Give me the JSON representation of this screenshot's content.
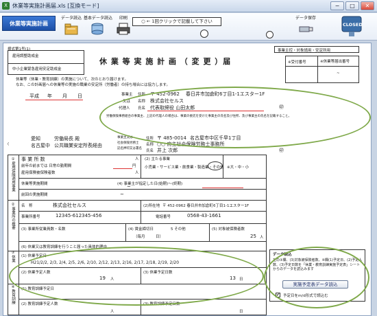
{
  "window": {
    "title": "休業等実施計画届.xls [互換モード]",
    "min": "−",
    "max": "□",
    "close": "✕"
  },
  "toolbar": {
    "app_label": "休業等実施計画",
    "data_read": "データ読込",
    "basic_data_read": "基本データ読込",
    "print": "印刷",
    "memo": "○ ← 1回クリックで記載して下さい",
    "data_save": "データ保存",
    "closed": "CLOSED"
  },
  "form": {
    "form_no": "様式第1号(1)",
    "recipients": [
      "雇用調整助成金",
      "中小企業緊急雇用安定助成金"
    ],
    "title": "休 業 等 実 施 計 画 （ 変 更 ）届",
    "top_right_label": "事業主控・対象請用・安定所用",
    "side_labels": [
      "※受付番号",
      "※休業等届出番号"
    ],
    "side_tilde": "~",
    "intro_1": "休業等（休業・教育訓練）の実施について、次のとおり届けます。",
    "intro_2": "なお、この計画届への休業等の実施の職業の安定所（労働者）の持ち場合には協力します。",
    "date": {
      "era": "平成",
      "year": "年",
      "month": "月",
      "day": "日"
    },
    "employer": {
      "label": "事業主",
      "addr_label": "住所",
      "zip": "〒 452-0962",
      "address": "春日井市加倉町6丁目1-1エスター1F",
      "name_label": "名称",
      "name_prefix": "又は",
      "name": "株式会社セルス",
      "rep_label": "代理人",
      "rep_name_label": "氏名",
      "rep_name": "代表取締役 山田太郎",
      "seal": "㊞"
    },
    "small_note": "労働保険事務組合の事業主、上記の代理人の場合は、事業の委託を受けた事業主の氏名及び住所、及び事業主の氏名を記載すること。",
    "office": {
      "prefecture": "愛知",
      "bureau": "労働局長 殿",
      "second": "名古屋中",
      "office_name": "公共職業安定所長経由"
    },
    "agent": {
      "label_1": "事業主又は",
      "label_2": "社会保険労務士",
      "label_3": "記名押印又は署名",
      "addr_label": "住所",
      "zip": "〒 485-0014",
      "address": "名古屋市中区千早1丁目",
      "name_label": "名称",
      "name": "○○ 府主社会保険労務士事務所",
      "person_label": "氏名",
      "person": "井上 次郎",
      "seal": "㊞"
    },
    "section1": {
      "row_label_1": "雇用保険適用事業所",
      "col_business": "事 業 所 数",
      "col_business_unit": "人",
      "col_industry": "(2) 主たる事業",
      "row_prev": "前年の前までは 日常の勤期間",
      "row_prev_unit": "円",
      "row_workers": "雇用保険被保険者数",
      "row_workers_unit": "人",
      "industry_options": "小売業・サービス業・飲食業・製造業・その他",
      "industry_selected": "その他",
      "size_note": "※大・中・小",
      "period_label": "休業等実施期間",
      "period_value": "~",
      "period_note": "(4) 事業主が指定した日(始期)～(終期)",
      "prev_label": "前回の実施期間",
      "prev_value": "~"
    },
    "section2": {
      "name_label": "名　称",
      "name": "株式会社セルス",
      "addr_label": "(2)所在地",
      "addr": "〒 452-0962 春日井市加倉町6丁目1-1エスター1F",
      "insurance_label": "事業所番号",
      "insurance_no": "12345-612345-456",
      "tel_label": "電話番号",
      "tel": "0568-43-1661",
      "count_label": "(3) 事業所従業員数・名数",
      "wage_label": "(4) 賃金締切日",
      "wage_cycle": "（毎月",
      "wage_day": "日）",
      "wage_other": "5 その他",
      "target_label": "(5) 対象被保険者数",
      "target_value": "25",
      "target_unit": "人",
      "applied_label": "(6) 休業又は教育訓練を行うこと届った具体的理由"
    },
    "section3": {
      "days_label": "(1) 休業予定日",
      "days_value": "H21/2/2, 2/3, 2/4, 2/5, 2/6, 2/10, 2/12, 2/13, 2/16, 2/17, 2/18, 2/19, 2/20",
      "workers_label": "(2) 休業予定人数",
      "workers_value": "19",
      "workers_unit": "人",
      "days_count_label": "(3) 休業予定日数",
      "days_count_value": "13",
      "days_count_unit": "日"
    },
    "section4": {
      "edu_days_label": "(1) 教育訓練予定日",
      "edu_workers_label": "(2) 教育訓練予定人数",
      "edu_workers_unit": "人",
      "edu_days_count_label": "(3) 教育訓練予定日数",
      "edu_days_count_unit": "日"
    },
    "left_sections": [
      "①雇用保険適用事業",
      "②事業所の概要",
      "③休業",
      "④教育訓練"
    ],
    "panel": {
      "title": "データ読込",
      "text": "左の③欄、(3)対象被保険者数、④欄(1)予定日、(2)予定人数、(3)予定日数を「休業・教育訓練実施予定表」シートからのデータを読込みます",
      "button": "実施予定表データ読込",
      "check_label": "予定日をm/d形式で読込む",
      "check_mark": "✔"
    }
  }
}
